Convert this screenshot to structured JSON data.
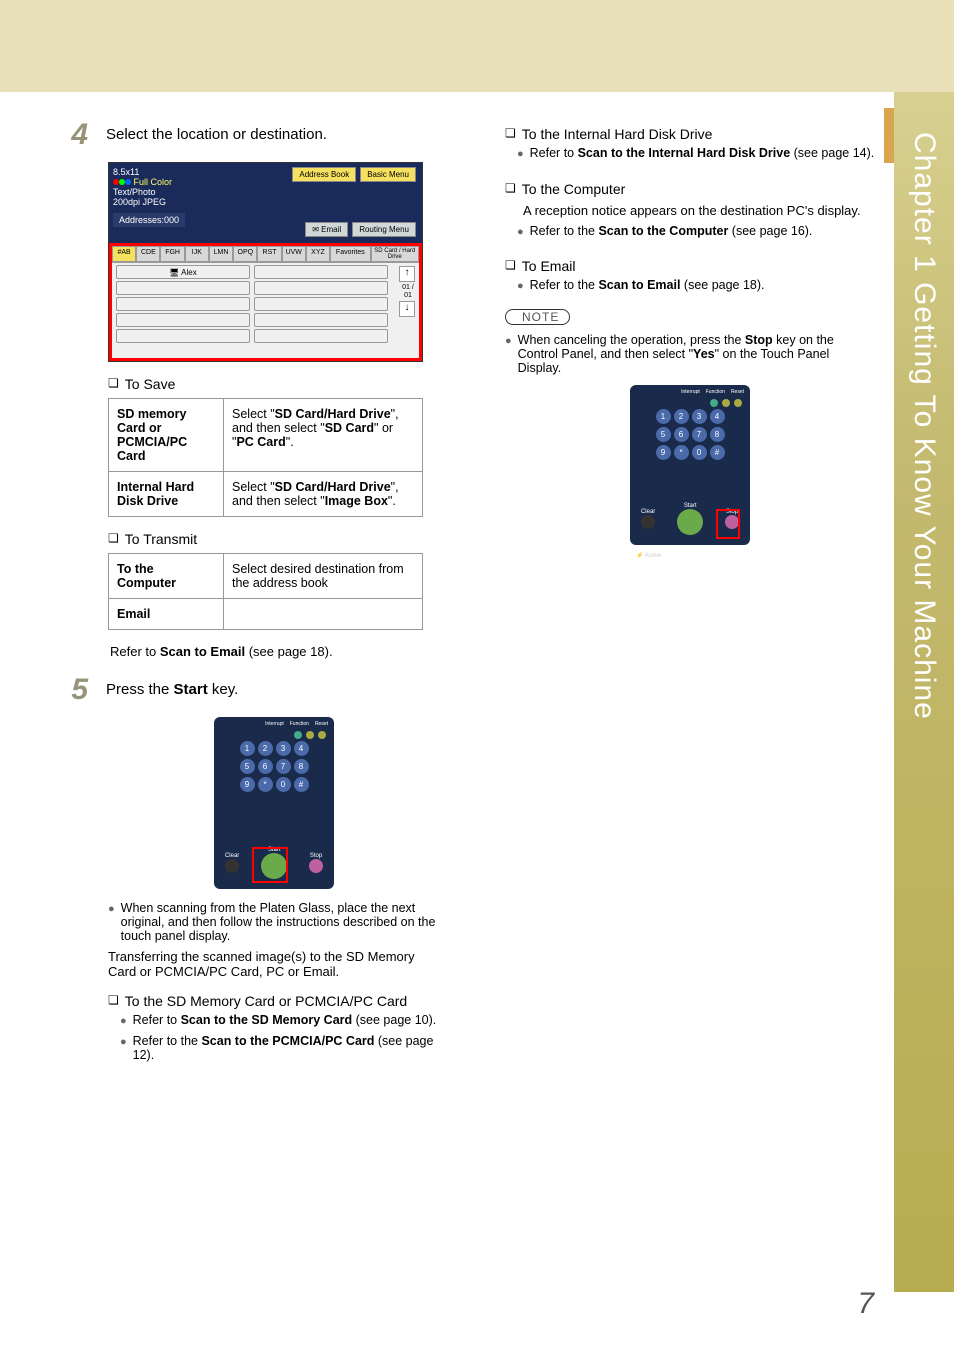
{
  "sideTab": "Chapter 1    Getting To Know Your Machine",
  "pageNumber": "7",
  "step4": {
    "num": "4",
    "text": "Select the location or destination."
  },
  "ss1": {
    "size": "8.5x11",
    "color": "Full Color",
    "mode": "Text/Photo",
    "res": "200dpi JPEG",
    "addr": "Addresses:000",
    "btnAddr": "Address Book",
    "btnBasic": "Basic Menu",
    "btnEmail": "Email",
    "btnRoute": "Routing Menu",
    "tabs": [
      "#AB",
      "CDE",
      "FGH",
      "IJK",
      "LMN",
      "OPQ",
      "RST",
      "UVW",
      "XYZ",
      "Favorites",
      "SD Card / Hard Drive"
    ],
    "entry": "Alex",
    "page": "01 / 01"
  },
  "toSave": "To Save",
  "saveTable": {
    "r1c1": "SD memory Card or PCMCIA/PC Card",
    "r1c2_a": "Select \"",
    "r1c2_b": "SD Card/Hard Drive",
    "r1c2_c": "\", and then select \"",
    "r1c2_d": "SD Card",
    "r1c2_e": "\" or \"",
    "r1c2_f": "PC Card",
    "r1c2_g": "\".",
    "r2c1": "Internal Hard Disk Drive",
    "r2c2_a": "Select \"",
    "r2c2_b": "SD Card/Hard Drive",
    "r2c2_c": "\", and then select \"",
    "r2c2_d": "Image Box",
    "r2c2_e": "\"."
  },
  "toTransmit": "To Transmit",
  "transmitTable": {
    "r1c1": "To the Computer",
    "r1c2": "Select desired destination from the address book",
    "r2c1": "Email"
  },
  "transmitNote_a": "Refer to ",
  "transmitNote_b": "Scan to Email",
  "transmitNote_c": " (see page 18).",
  "step5": {
    "num": "5",
    "text_a": "Press the ",
    "text_b": "Start",
    "text_c": " key."
  },
  "panel": {
    "labels": [
      "Interrupt",
      "Function",
      "Reset"
    ],
    "keys": [
      "1",
      "2",
      "3",
      "4",
      "5",
      "6",
      "7",
      "8",
      "9",
      "*",
      "0",
      "#"
    ],
    "clear": "Clear",
    "start": "Start",
    "stop": "Stop",
    "active": "Active"
  },
  "step5bullet": "When scanning from the Platen Glass, place the next original, and then follow the instructions described on the touch panel display.",
  "step5para": "Transferring the scanned image(s) to the SD Memory Card or PCMCIA/PC Card, PC or Email.",
  "left_toSD": "To the SD Memory Card or PCMCIA/PC Card",
  "left_sd_b1_a": "Refer to ",
  "left_sd_b1_b": "Scan to the SD Memory Card",
  "left_sd_b1_c": " (see page 10).",
  "left_sd_b2_a": "Refer to the ",
  "left_sd_b2_b": "Scan to the PCMCIA/PC Card",
  "left_sd_b2_c": " (see page 12).",
  "r_hd": "To the Internal Hard Disk Drive",
  "r_hd_b_a": "Refer to ",
  "r_hd_b_b": "Scan to the Internal Hard Disk Drive",
  "r_hd_b_c": " (see page 14).",
  "r_comp": "To the Computer",
  "r_comp_p": "A reception notice appears on the destination PC's display.",
  "r_comp_b_a": "Refer to the ",
  "r_comp_b_b": "Scan to the Computer",
  "r_comp_b_c": " (see page 16).",
  "r_email": "To Email",
  "r_email_b_a": "Refer to the ",
  "r_email_b_b": "Scan to Email",
  "r_email_b_c": " (see page 18).",
  "noteLabel": "NOTE",
  "note_a": "When canceling the operation, press the ",
  "note_b": "Stop",
  "note_c": " key on the Control Panel, and then select \"",
  "note_d": "Yes",
  "note_e": "\" on the Touch Panel Display."
}
